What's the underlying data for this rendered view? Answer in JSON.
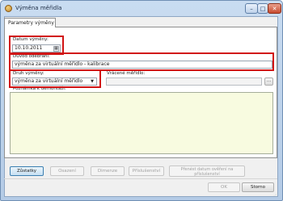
{
  "window": {
    "title": "Výměna měřidla"
  },
  "tabs": [
    {
      "label": "Parametry výměny"
    }
  ],
  "form": {
    "date_label": "Datum výměny:",
    "date_value": "10.10.2011",
    "reason_label": "Důvod odebrání:",
    "reason_value": "výměna za virtuální měřidlo - kalibrace",
    "type_label": "Druh výměny:",
    "type_value": "výměna za virtuální měřidlo",
    "returned_label": "Vrácené měřidlo:",
    "returned_value": "",
    "returned_browse": "...",
    "notes_label": "Poznámka k demontáži:",
    "notes_value": ""
  },
  "buttons": {
    "zustatky": "Zůstatky",
    "osazeni": "Osazení",
    "dimenze": "Dimenze",
    "prislusenstvi": "Příslušenství",
    "prenest": "Přenést datum ověření na příslušenství",
    "ok": "OK",
    "storno": "Storno"
  },
  "icons": {
    "date_picker": "calendar-icon",
    "combo": "chevron-down-icon"
  }
}
